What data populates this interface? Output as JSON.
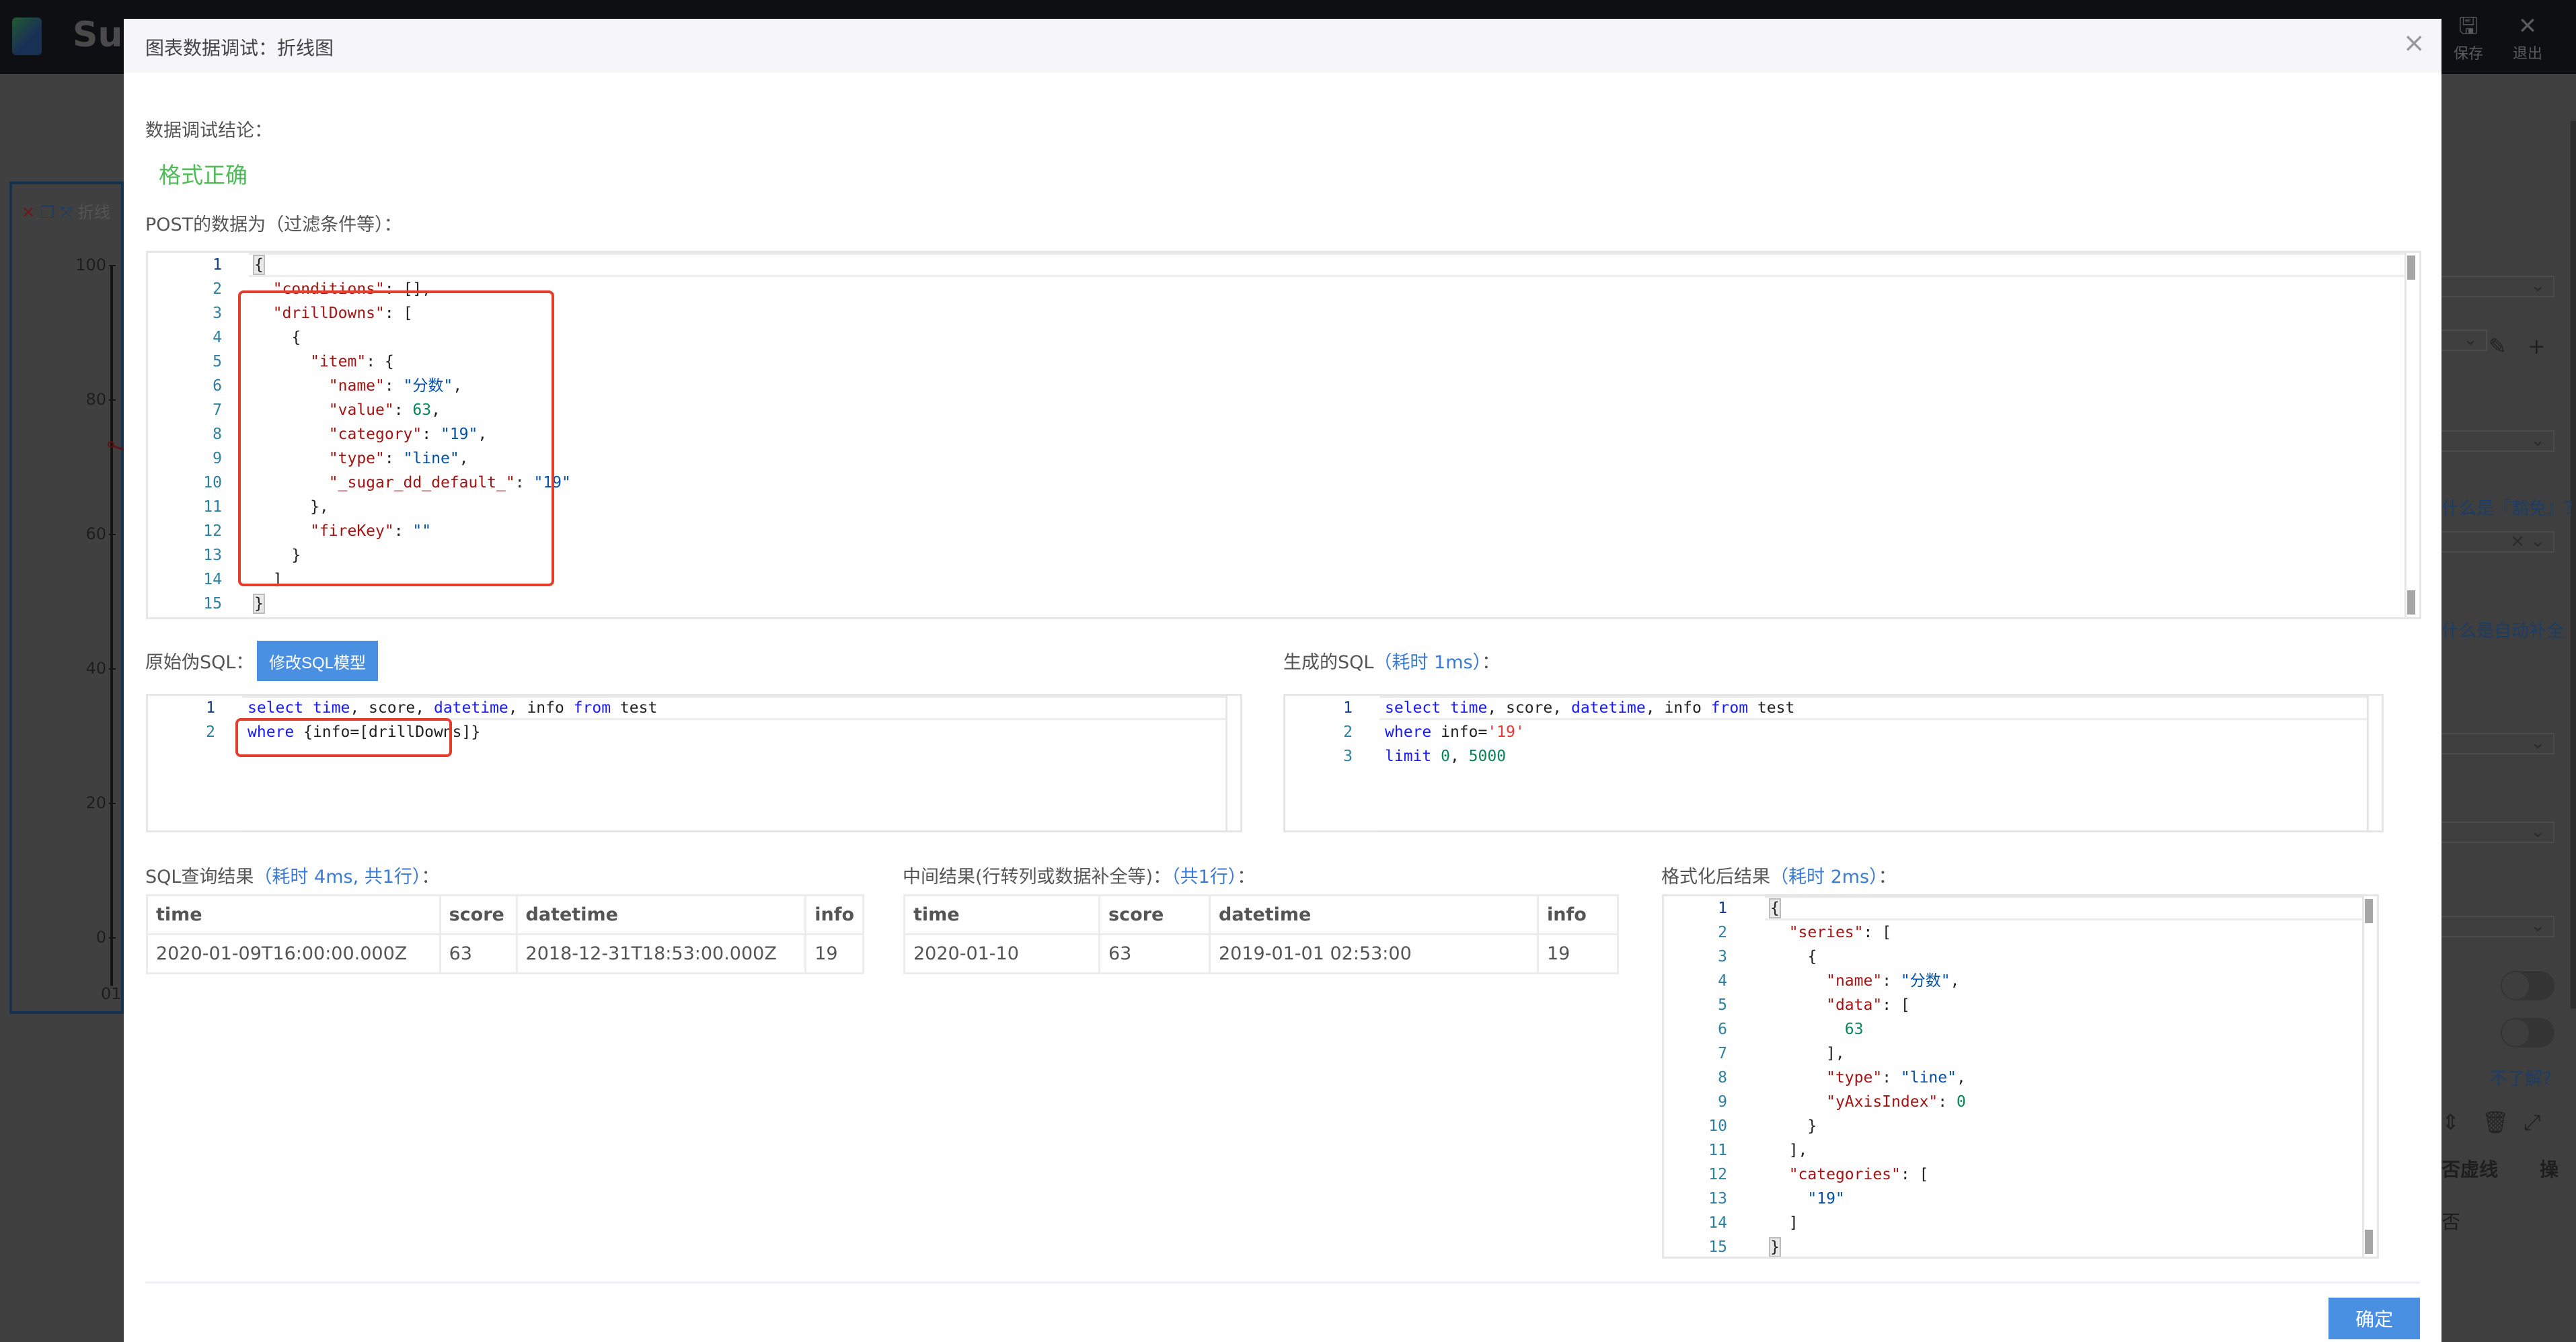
{
  "background": {
    "brand_partial": "Sug",
    "toolbar": [
      {
        "icon": "save-icon",
        "glyph": "🖫",
        "label": "保存"
      },
      {
        "icon": "exit-icon",
        "glyph": "✕",
        "label": "退出"
      }
    ],
    "chart_widget": {
      "tools": {
        "delete": "✕",
        "copy": "❐",
        "resize": "⤧",
        "title_partial": "折线"
      },
      "y_ticks": [
        "100",
        "80",
        "60",
        "40",
        "20",
        "0"
      ],
      "x_tick": "01"
    },
    "right_panel": {
      "link_alias": "什么是『豁免』？",
      "link_autofill": "什么是自动补全",
      "link_help": "不了解?",
      "col_dashed": "否虚线",
      "col_ops": "操",
      "select_value": "否"
    }
  },
  "modal": {
    "title": "图表数据调试：折线图",
    "close_icon": "×",
    "conclusion_label": "数据调试结论：",
    "conclusion_value": "格式正确",
    "conclusion_color": "#4fbb58",
    "post_label": "POST的数据为（过滤条件等）：",
    "post_code": {
      "line_numbers": [
        "1",
        "2",
        "3",
        "4",
        "5",
        "6",
        "7",
        "8",
        "9",
        "10",
        "11",
        "12",
        "13",
        "14",
        "15"
      ],
      "lines": [
        [
          {
            "t": "{",
            "c": ""
          }
        ],
        [
          {
            "t": "  ",
            "c": ""
          },
          {
            "t": "\"conditions\"",
            "c": "p"
          },
          {
            "t": ": [],",
            "c": ""
          }
        ],
        [
          {
            "t": "  ",
            "c": ""
          },
          {
            "t": "\"drillDowns\"",
            "c": "p"
          },
          {
            "t": ": [",
            "c": ""
          }
        ],
        [
          {
            "t": "    {",
            "c": ""
          }
        ],
        [
          {
            "t": "      ",
            "c": ""
          },
          {
            "t": "\"item\"",
            "c": "p"
          },
          {
            "t": ": {",
            "c": ""
          }
        ],
        [
          {
            "t": "        ",
            "c": ""
          },
          {
            "t": "\"name\"",
            "c": "p"
          },
          {
            "t": ": ",
            "c": ""
          },
          {
            "t": "\"分数\"",
            "c": "s"
          },
          {
            "t": ",",
            "c": ""
          }
        ],
        [
          {
            "t": "        ",
            "c": ""
          },
          {
            "t": "\"value\"",
            "c": "p"
          },
          {
            "t": ": ",
            "c": ""
          },
          {
            "t": "63",
            "c": "n"
          },
          {
            "t": ",",
            "c": ""
          }
        ],
        [
          {
            "t": "        ",
            "c": ""
          },
          {
            "t": "\"category\"",
            "c": "p"
          },
          {
            "t": ": ",
            "c": ""
          },
          {
            "t": "\"19\"",
            "c": "s"
          },
          {
            "t": ",",
            "c": ""
          }
        ],
        [
          {
            "t": "        ",
            "c": ""
          },
          {
            "t": "\"type\"",
            "c": "p"
          },
          {
            "t": ": ",
            "c": ""
          },
          {
            "t": "\"line\"",
            "c": "s"
          },
          {
            "t": ",",
            "c": ""
          }
        ],
        [
          {
            "t": "        ",
            "c": ""
          },
          {
            "t": "\"_sugar_dd_default_\"",
            "c": "p"
          },
          {
            "t": ": ",
            "c": ""
          },
          {
            "t": "\"19\"",
            "c": "s"
          }
        ],
        [
          {
            "t": "      },",
            "c": ""
          }
        ],
        [
          {
            "t": "      ",
            "c": ""
          },
          {
            "t": "\"fireKey\"",
            "c": "p"
          },
          {
            "t": ": ",
            "c": ""
          },
          {
            "t": "\"\"",
            "c": "s"
          }
        ],
        [
          {
            "t": "    }",
            "c": ""
          }
        ],
        [
          {
            "t": "  ]",
            "c": ""
          }
        ],
        [
          {
            "t": "}",
            "c": ""
          }
        ]
      ]
    },
    "raw_sql_label": "原始伪SQL：",
    "edit_sql_button": "修改SQL模型",
    "raw_sql": {
      "line_numbers": [
        "1",
        "2"
      ],
      "lines": [
        [
          {
            "t": "select",
            "c": "k"
          },
          {
            "t": " ",
            "c": ""
          },
          {
            "t": "time",
            "c": "k"
          },
          {
            "t": ", score, ",
            "c": ""
          },
          {
            "t": "datetime",
            "c": "k"
          },
          {
            "t": ", info ",
            "c": ""
          },
          {
            "t": "from",
            "c": "k"
          },
          {
            "t": " test",
            "c": ""
          }
        ],
        [
          {
            "t": "where",
            "c": "k"
          },
          {
            "t": " {info=[drillDowns]}",
            "c": ""
          }
        ]
      ]
    },
    "gen_sql_label": "生成的SQL",
    "gen_sql_meta": "（耗时 1ms）",
    "gen_sql_suffix": "：",
    "gen_sql": {
      "line_numbers": [
        "1",
        "2",
        "3"
      ],
      "lines": [
        [
          {
            "t": "select",
            "c": "k"
          },
          {
            "t": " ",
            "c": ""
          },
          {
            "t": "time",
            "c": "k"
          },
          {
            "t": ", score, ",
            "c": ""
          },
          {
            "t": "datetime",
            "c": "k"
          },
          {
            "t": ", info ",
            "c": ""
          },
          {
            "t": "from",
            "c": "k"
          },
          {
            "t": " test",
            "c": ""
          }
        ],
        [
          {
            "t": "where",
            "c": "k"
          },
          {
            "t": " info=",
            "c": ""
          },
          {
            "t": "'19'",
            "c": "sq"
          }
        ],
        [
          {
            "t": "limit",
            "c": "k"
          },
          {
            "t": " ",
            "c": ""
          },
          {
            "t": "0",
            "c": "n"
          },
          {
            "t": ", ",
            "c": ""
          },
          {
            "t": "5000",
            "c": "n"
          }
        ]
      ]
    },
    "sql_result": {
      "label": "SQL查询结果",
      "meta": "（耗时 4ms, 共1行）",
      "suffix": "：",
      "columns": [
        "time",
        "score",
        "datetime",
        "info"
      ],
      "rows": [
        [
          "2020-01-09T16:00:00.000Z",
          "63",
          "2018-12-31T18:53:00.000Z",
          "19"
        ]
      ]
    },
    "mid_result": {
      "label": "中间结果(行转列或数据补全等)：",
      "meta": "（共1行）",
      "suffix": "：",
      "columns": [
        "time",
        "score",
        "datetime",
        "info"
      ],
      "rows": [
        [
          "2020-01-10",
          "63",
          "2019-01-01 02:53:00",
          "19"
        ]
      ]
    },
    "formatted_result": {
      "label": "格式化后结果",
      "meta": "（耗时 2ms）",
      "suffix": "：",
      "line_numbers": [
        "1",
        "2",
        "3",
        "4",
        "5",
        "6",
        "7",
        "8",
        "9",
        "10",
        "11",
        "12",
        "13",
        "14",
        "15"
      ],
      "lines": [
        [
          {
            "t": "{",
            "c": ""
          }
        ],
        [
          {
            "t": "  ",
            "c": ""
          },
          {
            "t": "\"series\"",
            "c": "p"
          },
          {
            "t": ": [",
            "c": ""
          }
        ],
        [
          {
            "t": "    {",
            "c": ""
          }
        ],
        [
          {
            "t": "      ",
            "c": ""
          },
          {
            "t": "\"name\"",
            "c": "p"
          },
          {
            "t": ": ",
            "c": ""
          },
          {
            "t": "\"分数\"",
            "c": "s"
          },
          {
            "t": ",",
            "c": ""
          }
        ],
        [
          {
            "t": "      ",
            "c": ""
          },
          {
            "t": "\"data\"",
            "c": "p"
          },
          {
            "t": ": [",
            "c": ""
          }
        ],
        [
          {
            "t": "        ",
            "c": ""
          },
          {
            "t": "63",
            "c": "n"
          }
        ],
        [
          {
            "t": "      ],",
            "c": ""
          }
        ],
        [
          {
            "t": "      ",
            "c": ""
          },
          {
            "t": "\"type\"",
            "c": "p"
          },
          {
            "t": ": ",
            "c": ""
          },
          {
            "t": "\"line\"",
            "c": "s"
          },
          {
            "t": ",",
            "c": ""
          }
        ],
        [
          {
            "t": "      ",
            "c": ""
          },
          {
            "t": "\"yAxisIndex\"",
            "c": "p"
          },
          {
            "t": ": ",
            "c": ""
          },
          {
            "t": "0",
            "c": "n"
          }
        ],
        [
          {
            "t": "    }",
            "c": ""
          }
        ],
        [
          {
            "t": "  ],",
            "c": ""
          }
        ],
        [
          {
            "t": "  ",
            "c": ""
          },
          {
            "t": "\"categories\"",
            "c": "p"
          },
          {
            "t": ": [",
            "c": ""
          }
        ],
        [
          {
            "t": "    ",
            "c": ""
          },
          {
            "t": "\"19\"",
            "c": "s"
          }
        ],
        [
          {
            "t": "  ]",
            "c": ""
          }
        ],
        [
          {
            "t": "}",
            "c": ""
          }
        ]
      ]
    },
    "confirm_button": "确定",
    "accent_color": "#4a90e2",
    "highlight_color": "#e33d2b"
  }
}
